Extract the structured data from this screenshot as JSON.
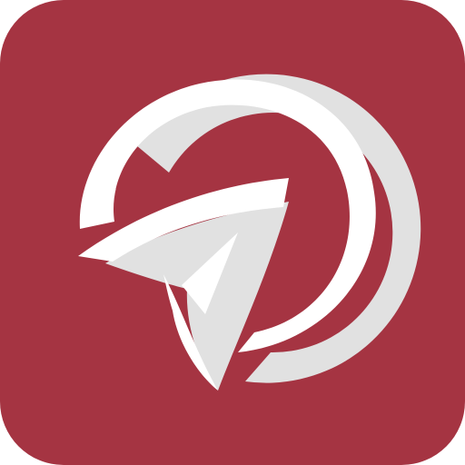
{
  "icon": {
    "name": "app-logo-icon",
    "description_name": "paper-plane-circle-logo",
    "colors": {
      "background": "#A53442",
      "foreground": "#FFFFFF",
      "shadow": "#E1E1E1"
    }
  }
}
